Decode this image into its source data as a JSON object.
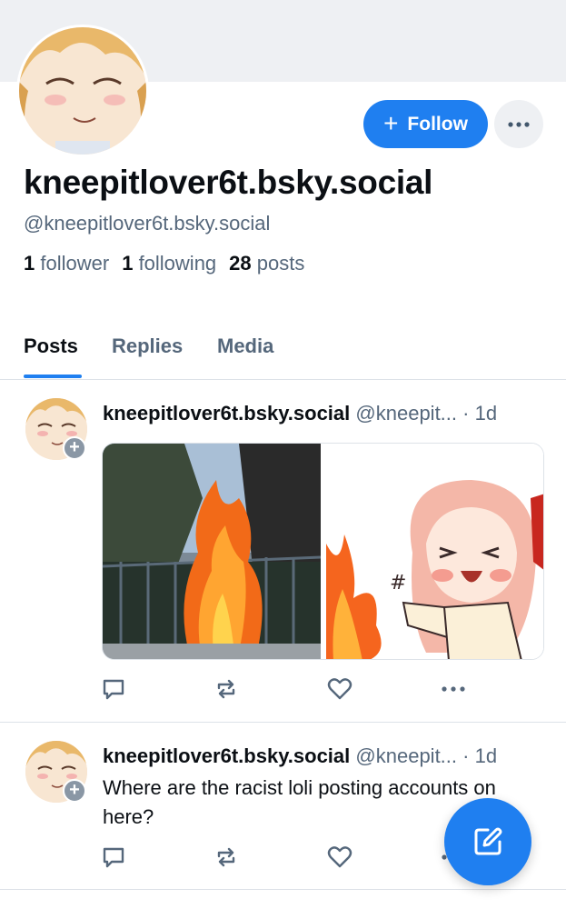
{
  "profile": {
    "display_name": "kneepitlover6t.bsky.social",
    "handle": "@kneepitlover6t.bsky.social",
    "followers_count": "1",
    "followers_label": "follower",
    "following_count": "1",
    "following_label": "following",
    "posts_count": "28",
    "posts_label": "posts",
    "follow_label": "Follow",
    "more_glyph": "•••"
  },
  "tabs": [
    {
      "label": "Posts",
      "active": true
    },
    {
      "label": "Replies",
      "active": false
    },
    {
      "label": "Media",
      "active": false
    }
  ],
  "posts": [
    {
      "author": "kneepitlover6t.bsky.social",
      "handle": "@kneepit...",
      "time": "· 1d",
      "text": "",
      "images": [
        "fire-photo",
        "anime-character-sticker"
      ]
    },
    {
      "author": "kneepitlover6t.bsky.social",
      "handle": "@kneepit...",
      "time": "· 1d",
      "text": "Where are the racist loli posting accounts on here?"
    }
  ],
  "colors": {
    "accent": "#1f7ff0",
    "muted": "#55677b",
    "banner": "#eef0f3"
  },
  "icons": [
    "plus-icon",
    "ellipsis-icon",
    "reply-icon",
    "repost-icon",
    "like-icon",
    "compose-icon"
  ]
}
